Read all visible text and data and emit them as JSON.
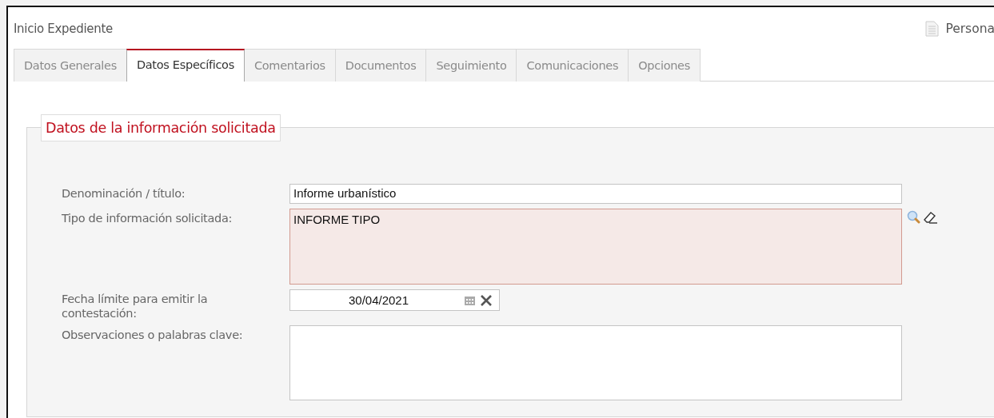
{
  "header": {
    "title": "Inicio Expediente",
    "link": "Persona"
  },
  "tabs": [
    {
      "label": "Datos Generales",
      "selected": false
    },
    {
      "label": "Datos Específicos",
      "selected": true
    },
    {
      "label": "Comentarios",
      "selected": false
    },
    {
      "label": "Documentos",
      "selected": false
    },
    {
      "label": "Seguimiento",
      "selected": false
    },
    {
      "label": "Comunicaciones",
      "selected": false
    },
    {
      "label": "Opciones",
      "selected": false
    }
  ],
  "section": {
    "legend": "Datos de la información solicitada",
    "fields": [
      {
        "kind": "text",
        "label": "Denominación / título:",
        "value": "Informe urbanístico",
        "required": false
      },
      {
        "kind": "lookup",
        "label": "Tipo de información solicitada:",
        "value": "INFORME TIPO",
        "required": true
      },
      {
        "kind": "date",
        "label": "Fecha límite para emitir la contestación:",
        "value": "30/04/2021",
        "required": false
      },
      {
        "kind": "textarea",
        "label": "Observaciones o palabras clave:",
        "required": false
      }
    ]
  }
}
